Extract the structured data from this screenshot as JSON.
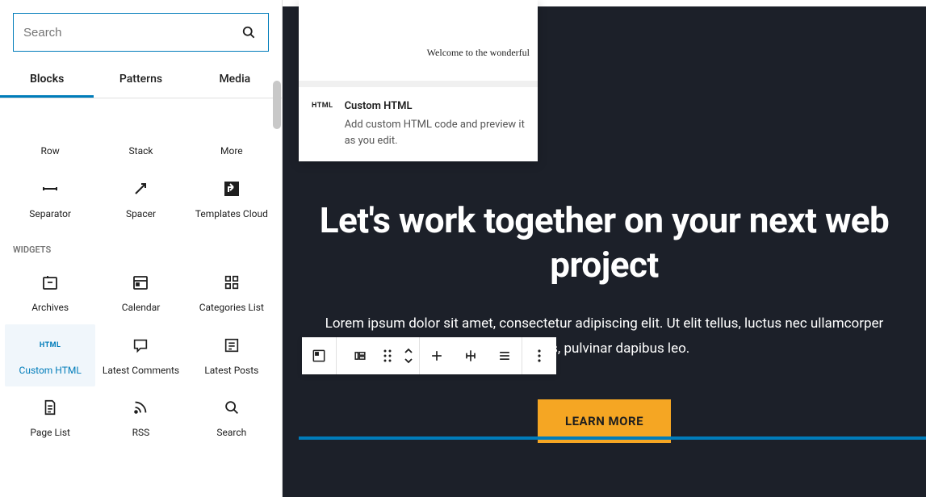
{
  "search": {
    "placeholder": "Search"
  },
  "tabs": {
    "blocks": "Blocks",
    "patterns": "Patterns",
    "media": "Media"
  },
  "row1": {
    "row": "Row",
    "stack": "Stack",
    "more": "More"
  },
  "row2": {
    "separator": "Separator",
    "spacer": "Spacer",
    "templates": "Templates Cloud"
  },
  "widgets_heading": "Widgets",
  "widgets1": {
    "archives": "Archives",
    "calendar": "Calendar",
    "categories": "Categories List"
  },
  "widgets2": {
    "customhtml_badge": "HTML",
    "customhtml": "Custom HTML",
    "latestcomments": "Latest Comments",
    "latestposts": "Latest Posts"
  },
  "widgets3": {
    "pagelist": "Page List",
    "rss": "RSS",
    "search": "Search"
  },
  "popover": {
    "preview_text": "Welcome to the wonderful",
    "badge": "HTML",
    "title": "Custom HTML",
    "desc": "Add custom HTML code and preview it as you edit."
  },
  "hero": {
    "title": "Let's work together on your next web project",
    "body": "Lorem ipsum dolor sit amet, consectetur adipiscing elit. Ut elit tellus, luctus nec ullamcorper mattis, pulvinar dapibus leo.",
    "cta": "LEARN MORE"
  }
}
